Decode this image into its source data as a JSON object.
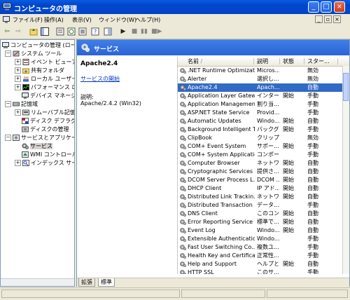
{
  "window": {
    "title": "コンピュータの管理"
  },
  "menubar": {
    "items": [
      "ファイル(F)",
      "操作(A)",
      "表示(V)",
      "ウィンドウ(W)",
      "ヘルプ(H)"
    ]
  },
  "tree": {
    "items": [
      {
        "label": "コンピュータの管理 (ローカル)",
        "exp": "",
        "icon": "computer-icon"
      },
      {
        "label": "システム ツール",
        "exp": "－",
        "icon": "tools-icon"
      },
      {
        "label": "イベント ビューア",
        "exp": "+",
        "icon": "event-viewer-icon"
      },
      {
        "label": "共有フォルダ",
        "exp": "+",
        "icon": "shared-folder-icon"
      },
      {
        "label": "ローカル ユーザーとグループ",
        "exp": "+",
        "icon": "users-icon"
      },
      {
        "label": "パフォーマンス ログと警告",
        "exp": "+",
        "icon": "performance-icon"
      },
      {
        "label": "デバイス マネージャ",
        "exp": "",
        "icon": "device-manager-icon"
      },
      {
        "label": "記憶域",
        "exp": "－",
        "icon": "storage-icon"
      },
      {
        "label": "リムーバブル記憶域",
        "exp": "+",
        "icon": "removable-storage-icon"
      },
      {
        "label": "ディスク デフラグ ツール",
        "exp": "",
        "icon": "defrag-icon"
      },
      {
        "label": "ディスクの管理",
        "exp": "",
        "icon": "disk-management-icon"
      },
      {
        "label": "サービスとアプリケーション",
        "exp": "－",
        "icon": "services-apps-icon"
      },
      {
        "label": "サービス",
        "exp": "",
        "icon": "services-icon"
      },
      {
        "label": "WMI コントロール",
        "exp": "",
        "icon": "wmi-icon"
      },
      {
        "label": "インデックス サービス",
        "exp": "+",
        "icon": "indexing-icon"
      }
    ]
  },
  "panel": {
    "title": "サービス"
  },
  "detail": {
    "name": "Apache2.4",
    "start_link": "サービスの開始",
    "desc_label": "説明:",
    "desc_text": "Apache/2.4.2 (Win32)"
  },
  "list": {
    "columns": [
      "名前",
      "説明",
      "状態",
      "スター..."
    ],
    "sort_indicator": "/",
    "rows": [
      [
        ".NET Runtime Optimizati...",
        "Micros...",
        "",
        "無効"
      ],
      [
        "Alerter",
        "選択し...",
        "",
        "無効"
      ],
      [
        "Apache2.4",
        "Apach...",
        "",
        "自動"
      ],
      [
        "Application Layer Gatew...",
        "インター...",
        "開始",
        "手動"
      ],
      [
        "Application Management",
        "割り当...",
        "",
        "手動"
      ],
      [
        "ASP.NET State Service",
        "Provid...",
        "",
        "手動"
      ],
      [
        "Automatic Updates",
        "Windo...",
        "開始",
        "自動"
      ],
      [
        "Background Intelligent T...",
        "バックグ...",
        "開始",
        "手動"
      ],
      [
        "ClipBook",
        "クリップ...",
        "",
        "無効"
      ],
      [
        "COM+ Event System",
        "サポー...",
        "開始",
        "手動"
      ],
      [
        "COM+ System Application",
        "コンポー...",
        "",
        "手動"
      ],
      [
        "Computer Browser",
        "ネットワ...",
        "開始",
        "自動"
      ],
      [
        "Cryptographic Services",
        "提供さ...",
        "開始",
        "自動"
      ],
      [
        "DCOM Server Process L...",
        "DCOM ...",
        "開始",
        "自動"
      ],
      [
        "DHCP Client",
        "IP アド...",
        "開始",
        "自動"
      ],
      [
        "Distributed Link Trackin...",
        "ネットワ...",
        "開始",
        "自動"
      ],
      [
        "Distributed Transaction ...",
        "データ...",
        "",
        "手動"
      ],
      [
        "DNS Client",
        "このコン...",
        "開始",
        "自動"
      ],
      [
        "Error Reporting Service",
        "標準で...",
        "開始",
        "自動"
      ],
      [
        "Event Log",
        "Windo...",
        "開始",
        "自動"
      ],
      [
        "Extensible Authenticatio...",
        "Windo...",
        "",
        "手動"
      ],
      [
        "Fast User Switching Co...",
        "複数ユ...",
        "",
        "手動"
      ],
      [
        "Health Key and Certifica...",
        "正常性...",
        "",
        "手動"
      ],
      [
        "Help and Support",
        "ヘルプと...",
        "開始",
        "自動"
      ],
      [
        "HTTP SSL",
        "このサ...",
        "",
        "手動"
      ]
    ],
    "selected_index": 2
  },
  "tabs": [
    "拡張",
    "標準"
  ],
  "colors": {
    "title_bar": "#0047d0",
    "panel_header": "#2c64d4",
    "selection": "#316ac5",
    "link": "#0033cc"
  }
}
